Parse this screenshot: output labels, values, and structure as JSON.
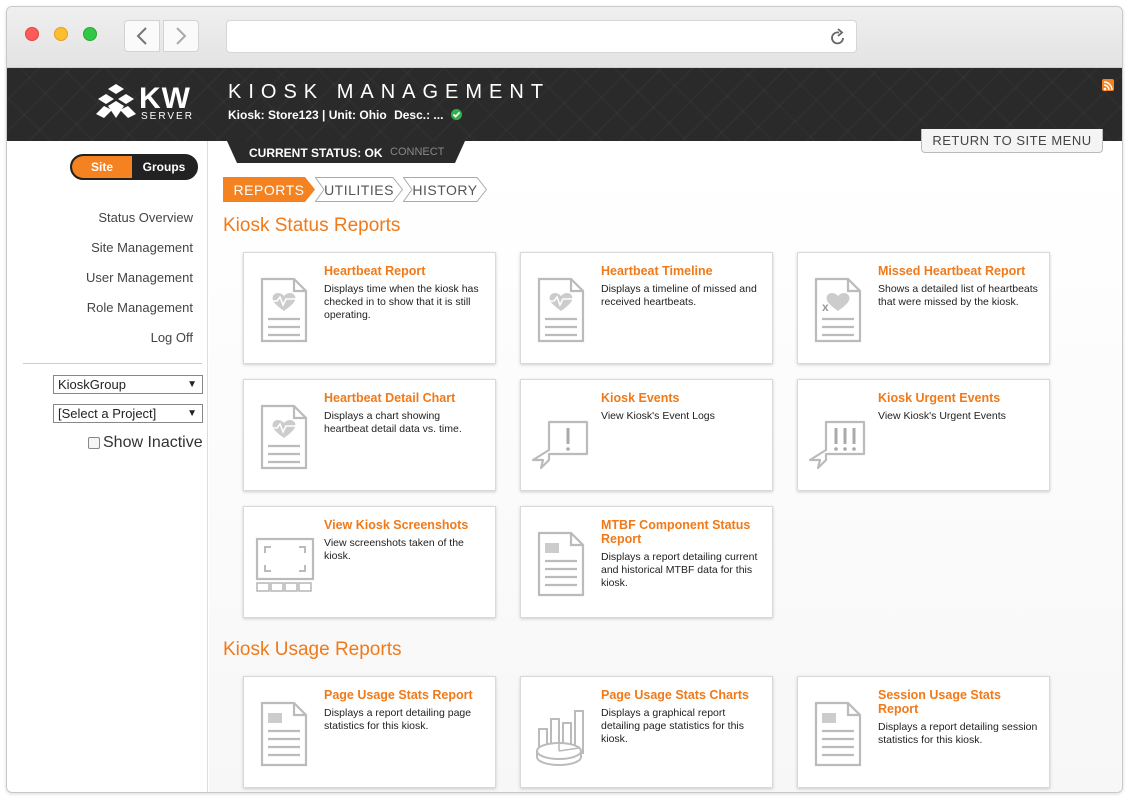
{
  "browser": {
    "url": ""
  },
  "header": {
    "logo_text": "KW",
    "logo_sub": "SERVER",
    "title": "KIOSK MANAGEMENT",
    "kiosk_info": "Kiosk: Store123 | Unit: Ohio",
    "desc": "Desc.: ...",
    "status": "CURRENT STATUS: OK",
    "connect": "CONNECT",
    "return_button": "RETURN TO SITE MENU"
  },
  "sidebar": {
    "toggle": {
      "site": "Site",
      "groups": "Groups"
    },
    "menu": [
      {
        "label": "Status Overview"
      },
      {
        "label": "Site Management"
      },
      {
        "label": "User Management"
      },
      {
        "label": "Role Management"
      },
      {
        "label": "Log Off"
      }
    ],
    "group_select": "KioskGroup",
    "project_select": "[Select a Project]",
    "show_inactive": "Show Inactive"
  },
  "tabs": [
    {
      "label": "REPORTS",
      "active": true
    },
    {
      "label": "UTILITIES",
      "active": false
    },
    {
      "label": "HISTORY",
      "active": false
    }
  ],
  "sections": {
    "status_title": "Kiosk Status Reports",
    "usage_title": "Kiosk Usage Reports"
  },
  "status_cards": [
    {
      "title": "Heartbeat Report",
      "desc": "Displays time when the kiosk has checked in to show that it is still operating.",
      "icon": "heartbeat-doc-icon"
    },
    {
      "title": "Heartbeat Timeline",
      "desc": "Displays a timeline of missed and received heartbeats.",
      "icon": "heartbeat-doc-icon"
    },
    {
      "title": "Missed Heartbeat Report",
      "desc": "Shows a detailed list of heartbeats that were missed by the kiosk.",
      "icon": "missed-heartbeat-doc-icon"
    },
    {
      "title": "Heartbeat Detail Chart",
      "desc": "Displays a chart showing heartbeat detail data vs. time.",
      "icon": "heartbeat-doc-icon"
    },
    {
      "title": "Kiosk Events",
      "desc": "View Kiosk's Event Logs",
      "icon": "event-bubble-icon"
    },
    {
      "title": "Kiosk Urgent Events",
      "desc": "View Kiosk's Urgent Events",
      "icon": "urgent-bubble-icon"
    },
    {
      "title": "View Kiosk Screenshots",
      "desc": "View screenshots taken of the kiosk.",
      "icon": "screenshot-icon"
    },
    {
      "title": "MTBF Component Status Report",
      "desc": "Displays a report detailing current and historical MTBF data for this kiosk.",
      "icon": "report-doc-icon"
    }
  ],
  "usage_cards": [
    {
      "title": "Page Usage Stats Report",
      "desc": "Displays a report detailing page statistics for this kiosk.",
      "icon": "report-doc-icon"
    },
    {
      "title": "Page Usage Stats Charts",
      "desc": "Displays a graphical report detailing page statistics for this kiosk.",
      "icon": "chart-icon"
    },
    {
      "title": "Session Usage Stats Report",
      "desc": "Displays a report detailing session statistics for this kiosk.",
      "icon": "report-doc-icon"
    }
  ],
  "colors": {
    "accent": "#f07a1a",
    "header_bg": "#2a2a2a"
  }
}
